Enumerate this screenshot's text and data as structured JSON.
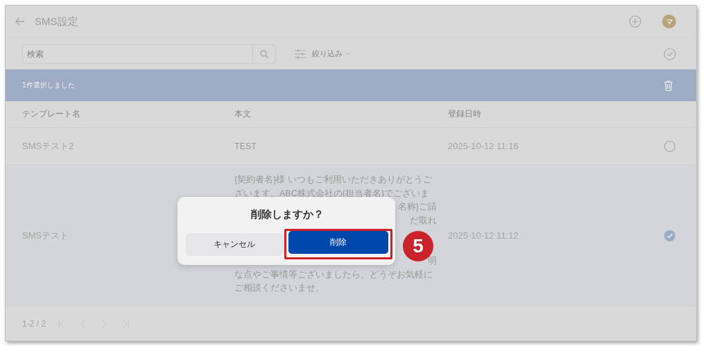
{
  "header": {
    "title": "SMS設定",
    "avatar": "マ"
  },
  "search": {
    "placeholder": "検索"
  },
  "filter": {
    "label": "絞り込み"
  },
  "selection_bar": {
    "text": "1件選択しました"
  },
  "table": {
    "columns": [
      "テンプレート名",
      "本文",
      "登録日時"
    ],
    "rows": [
      {
        "name": "SMSテスト2",
        "date": "2025-10-12 11:16",
        "selected": false,
        "body": [
          {
            "kind": "full",
            "text": "TEST"
          }
        ]
      },
      {
        "name": "SMSテスト",
        "date": "2025-10-12 11:12",
        "selected": true,
        "body": [
          {
            "kind": "full",
            "text": "{契約者名}様 いつもご利用いただきありがとうご"
          },
          {
            "kind": "full",
            "text": "ざいます。ABC株式会社の{担当者名}でございま"
          },
          {
            "kind": "tail",
            "text": "名称}ご請"
          },
          {
            "kind": "tail",
            "text": "だ取れ"
          },
          {
            "kind": "covered"
          },
          {
            "kind": "covered"
          },
          {
            "kind": "tail",
            "text": "明"
          },
          {
            "kind": "full",
            "text": "な点やご事情等ございましたら、どうぞお気軽に"
          },
          {
            "kind": "full",
            "text": "ご相談くださいませ。"
          }
        ]
      }
    ]
  },
  "pagination": {
    "range": "1-2 / 2"
  },
  "dialog": {
    "title": "削除しますか？",
    "buttons": [
      {
        "label": "キャンセル",
        "kind": "cancel",
        "highlighted": false
      },
      {
        "label": "削除",
        "kind": "primary",
        "highlighted": true
      }
    ]
  },
  "step_badge": "5"
}
